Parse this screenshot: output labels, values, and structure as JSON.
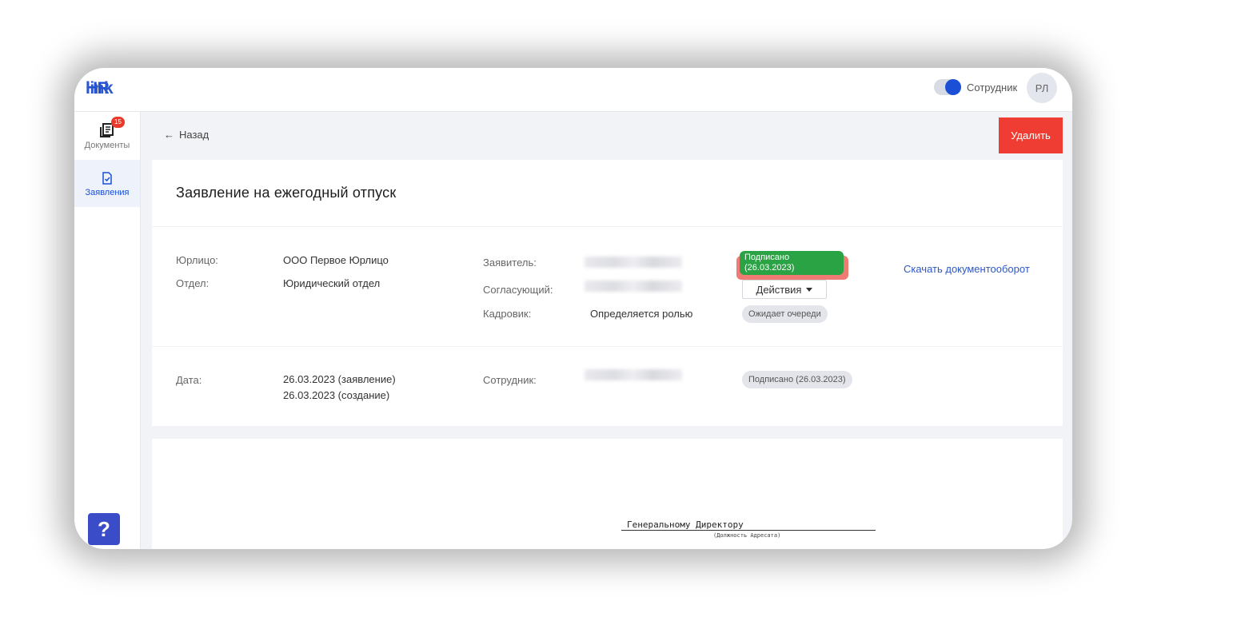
{
  "app": {
    "logo_hr": "HR",
    "logo_link": "link",
    "role_label": "Сотрудник",
    "avatar_initials": "РЛ",
    "accent_color": "#1a4fd6"
  },
  "sidebar": {
    "items": [
      {
        "label": "Документы",
        "icon": "documents-icon",
        "badge": "15",
        "active": false
      },
      {
        "label": "Заявления",
        "icon": "application-icon",
        "active": true
      }
    ],
    "help_label": "?"
  },
  "header": {
    "back_label": "Назад",
    "delete_label": "Удалить",
    "delete_color": "#ef3d33"
  },
  "document": {
    "title": "Заявление на ежегодный отпуск",
    "legal_entity_label": "Юрлицо:",
    "legal_entity_value": "ООО Первое Юрлицо",
    "department_label": "Отдел:",
    "department_value": "Юридический отдел",
    "applicant_label": "Заявитель:",
    "approver_label": "Согласующий:",
    "hr_label": "Кадровик:",
    "hr_value": "Определяется ролью",
    "applicant_status_line1": "Подписано",
    "applicant_status_line2": "(26.03.2023)",
    "actions_label": "Действия",
    "hr_status": "Ожидает очереди",
    "download_link": "Скачать документооборот",
    "date_label": "Дата:",
    "date_application": "26.03.2023 (заявление)",
    "date_created": "26.03.2023 (создание)",
    "employee_label": "Сотрудник:",
    "employee_status": "Подписано (26.03.2023)"
  },
  "preview": {
    "addressee": "Генеральному Директору",
    "addressee_caption": "(Должность Адресата)"
  }
}
